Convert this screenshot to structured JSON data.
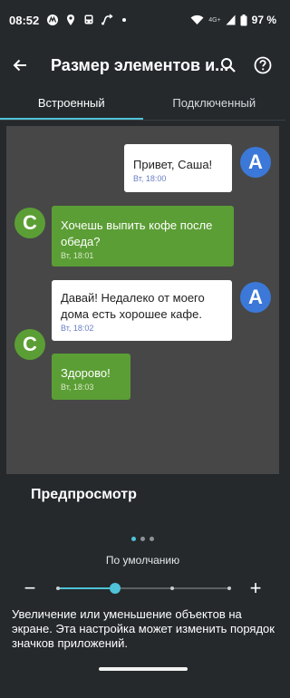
{
  "status_bar": {
    "time": "08:52",
    "network": "4G+",
    "battery": "97 %"
  },
  "app_bar": {
    "title": "Размер элементов и..."
  },
  "tabs": [
    {
      "label": "Встроенный",
      "active": true
    },
    {
      "label": "Подключенный",
      "active": false
    }
  ],
  "preview": {
    "messages": [
      {
        "text": "Привет, Саша!",
        "time": "Вт, 18:00",
        "avatar": "А"
      },
      {
        "text": "Хочешь выпить кофе после обеда?",
        "time": "Вт, 18:01",
        "avatar": "С"
      },
      {
        "text": "Давай! Недалеко от моего дома есть хорошее кафе.",
        "time": "Вт, 18:02",
        "avatar": "А"
      },
      {
        "text": "Здорово!",
        "time": "Вт, 18:03",
        "avatar": "С"
      }
    ]
  },
  "preview_label": "Предпросмотр",
  "pager": {
    "pages": 3,
    "current": 1
  },
  "scale": {
    "label": "По умолчанию",
    "minus": "−",
    "plus": "+",
    "steps": 4,
    "value_step": 1
  },
  "description": "Увеличение или уменьшение объектов на экране. Эта настройка может изменить порядок значков приложений.",
  "colors": {
    "accent": "#4fc3d8",
    "blue_avatar": "#3b78d8",
    "green_bubble": "#5b9e35",
    "background": "#25292c",
    "preview_bg": "#474747"
  }
}
